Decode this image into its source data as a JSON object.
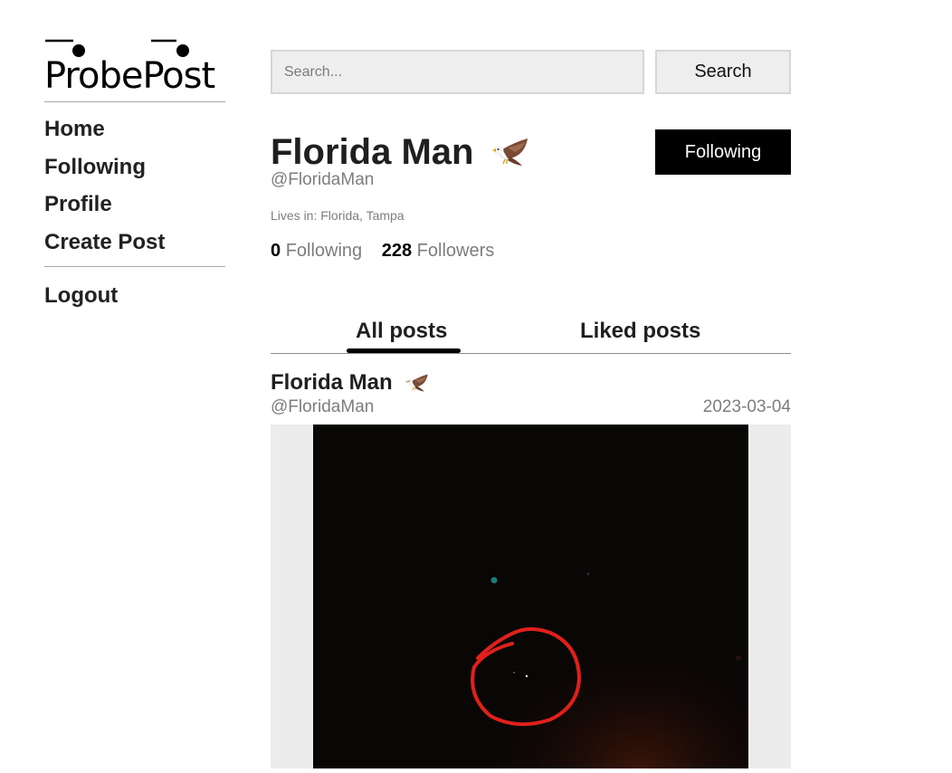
{
  "app": {
    "logo_text": "ProbePost"
  },
  "nav": {
    "items": [
      {
        "label": "Home"
      },
      {
        "label": "Following"
      },
      {
        "label": "Profile"
      },
      {
        "label": "Create Post"
      }
    ],
    "logout_label": "Logout"
  },
  "search": {
    "placeholder": "Search...",
    "value": "",
    "button_label": "Search"
  },
  "profile": {
    "name": "Florida Man",
    "handle": "@FloridaMan",
    "location_label": "Lives in:",
    "location": "Florida, Tampa",
    "following_count": "0",
    "following_label": "Following",
    "followers_count": "228",
    "followers_label": "Followers",
    "follow_button_label": "Following",
    "badge_icon": "eagle-icon"
  },
  "tabs": {
    "all_posts": "All posts",
    "liked_posts": "Liked posts",
    "active": "All posts"
  },
  "post": {
    "author": "Florida Man",
    "handle": "@FloridaMan",
    "date": "2023-03-04",
    "image_icon": "night-sky-photo"
  },
  "colors": {
    "accent": "#000000",
    "muted_text": "#7d7d7d",
    "input_bg": "#eeeeee",
    "annotation_circle": "#e0201a"
  }
}
